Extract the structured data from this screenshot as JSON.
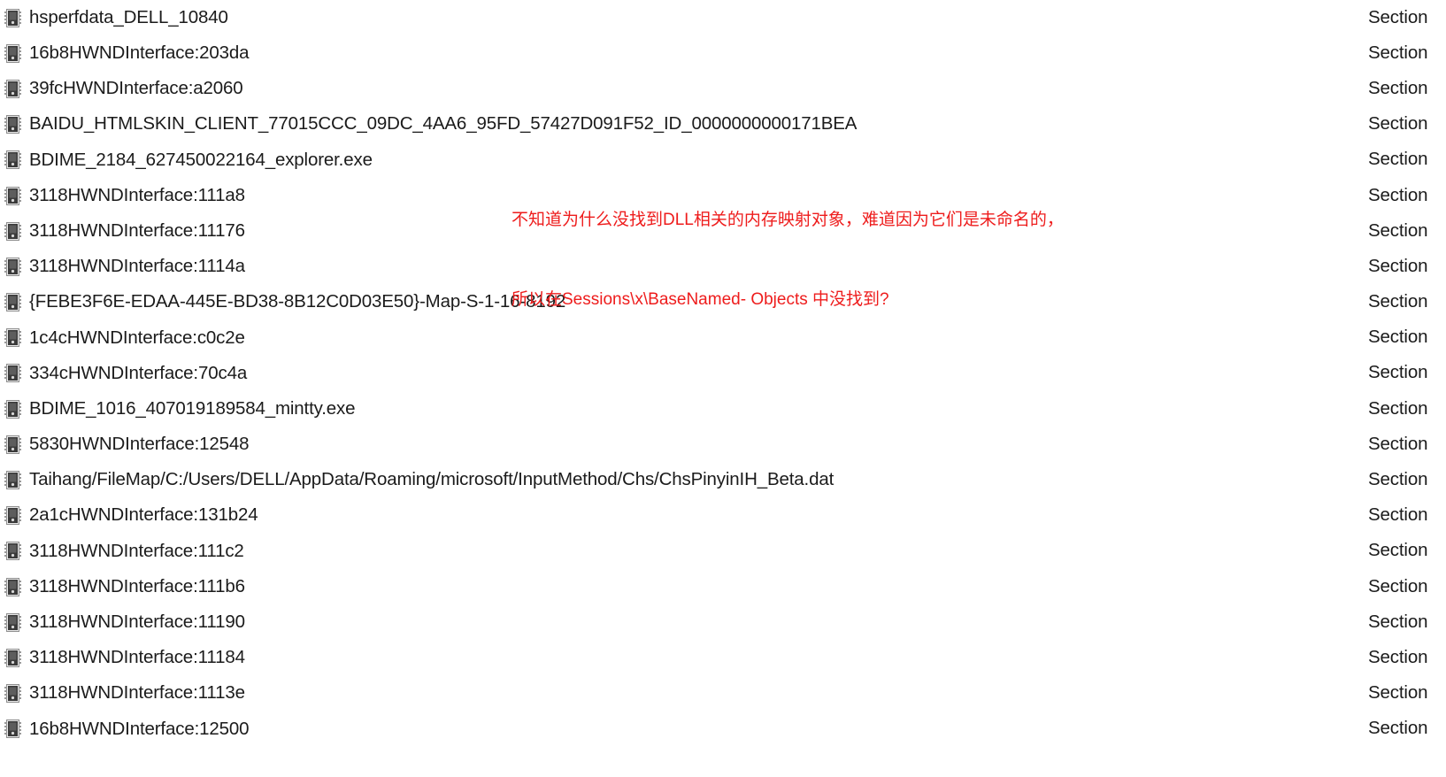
{
  "list": {
    "icon_name": "section-object-icon",
    "type_column_label": "Section",
    "rows": [
      {
        "name": "hsperfdata_DELL_10840",
        "type": "Section"
      },
      {
        "name": "16b8HWNDInterface:203da",
        "type": "Section"
      },
      {
        "name": "39fcHWNDInterface:a2060",
        "type": "Section"
      },
      {
        "name": "BAIDU_HTMLSKIN_CLIENT_77015CCC_09DC_4AA6_95FD_57427D091F52_ID_0000000000171BEA",
        "type": "Section"
      },
      {
        "name": "BDIME_2184_627450022164_explorer.exe",
        "type": "Section"
      },
      {
        "name": "3118HWNDInterface:111a8",
        "type": "Section"
      },
      {
        "name": "3118HWNDInterface:11176",
        "type": "Section"
      },
      {
        "name": "3118HWNDInterface:1114a",
        "type": "Section"
      },
      {
        "name": "{FEBE3F6E-EDAA-445E-BD38-8B12C0D03E50}-Map-S-1-16-8192",
        "type": "Section"
      },
      {
        "name": "1c4cHWNDInterface:c0c2e",
        "type": "Section"
      },
      {
        "name": "334cHWNDInterface:70c4a",
        "type": "Section"
      },
      {
        "name": "BDIME_1016_407019189584_mintty.exe",
        "type": "Section"
      },
      {
        "name": "5830HWNDInterface:12548",
        "type": "Section"
      },
      {
        "name": "Taihang/FileMap/C:/Users/DELL/AppData/Roaming/microsoft/InputMethod/Chs/ChsPinyinIH_Beta.dat",
        "type": "Section"
      },
      {
        "name": "2a1cHWNDInterface:131b24",
        "type": "Section"
      },
      {
        "name": "3118HWNDInterface:111c2",
        "type": "Section"
      },
      {
        "name": "3118HWNDInterface:111b6",
        "type": "Section"
      },
      {
        "name": "3118HWNDInterface:11190",
        "type": "Section"
      },
      {
        "name": "3118HWNDInterface:11184",
        "type": "Section"
      },
      {
        "name": "3118HWNDInterface:1113e",
        "type": "Section"
      },
      {
        "name": "16b8HWNDInterface:12500",
        "type": "Section"
      }
    ]
  },
  "annotation": {
    "color": "#ee1c1c",
    "line1": "不知道为什么没找到DLL相关的内存映射对象，难道因为它们是未命名的，",
    "line2": "所以在Sessions\\x\\BaseNamed- Objects 中没找到?"
  },
  "colors": {
    "background": "#ffffff",
    "text": "#1b1b1b",
    "annotation": "#ee1c1c",
    "icon_body": "#3a3a3a",
    "icon_pins": "#9a9a9a"
  }
}
